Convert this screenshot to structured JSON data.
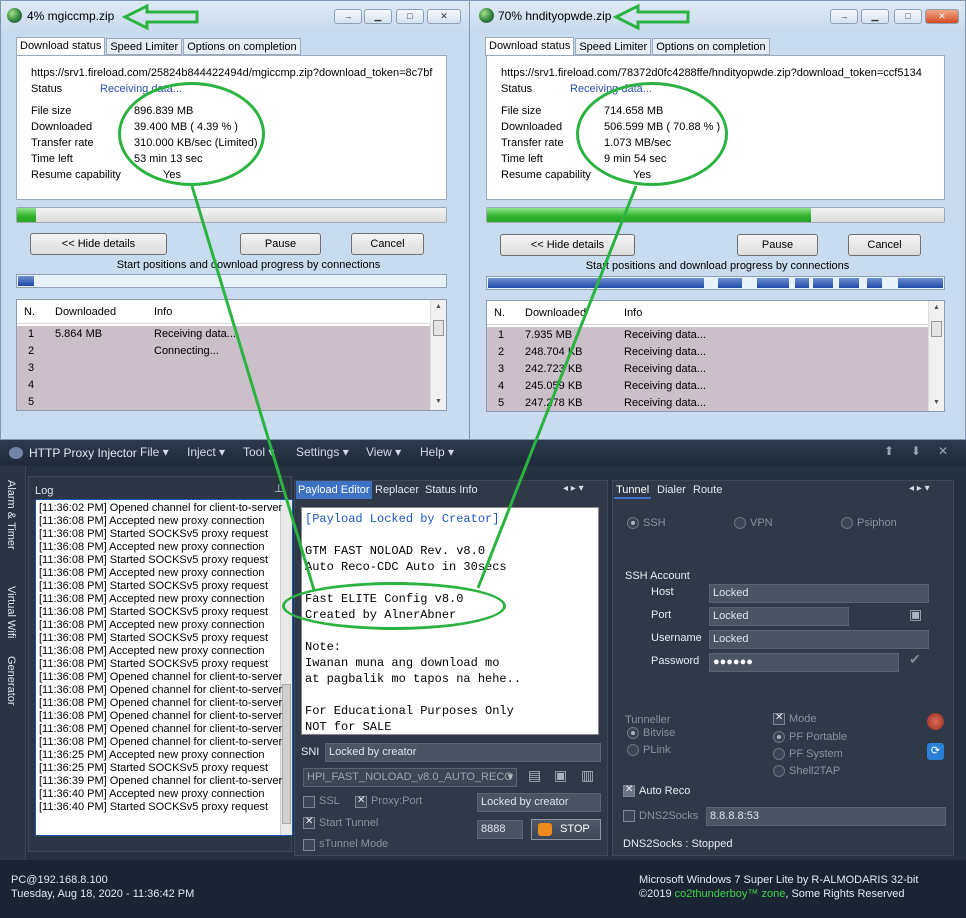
{
  "win1": {
    "title": "4% mgiccmp.zip",
    "tabs": [
      "Download status",
      "Speed Limiter",
      "Options on completion"
    ],
    "url": "https://srv1.fireload.com/25824b844422494d/mgiccmp.zip?download_token=8c7bf",
    "status_label": "Status",
    "status_value": "Receiving data...",
    "rows": [
      {
        "label": "File size",
        "value": "896.839 MB"
      },
      {
        "label": "Downloaded",
        "value": "39.400 MB ( 4.39 % )"
      },
      {
        "label": "Transfer rate",
        "value": "310.000 KB/sec (Limited)"
      },
      {
        "label": "Time left",
        "value": "53 min 13 sec"
      },
      {
        "label": "Resume capability",
        "value": "Yes"
      }
    ],
    "progress_pct": 4.39,
    "buttons": {
      "hide": "<< Hide details",
      "pause": "Pause",
      "cancel": "Cancel"
    },
    "caption": "Start positions and download progress by connections",
    "list_headers": [
      "N.",
      "Downloaded",
      "Info"
    ],
    "list_rows": [
      {
        "n": "1",
        "dl": "5.864  MB",
        "info": "Receiving data..."
      },
      {
        "n": "2",
        "dl": "",
        "info": "Connecting..."
      },
      {
        "n": "3",
        "dl": "",
        "info": ""
      },
      {
        "n": "4",
        "dl": "",
        "info": ""
      },
      {
        "n": "5",
        "dl": "",
        "info": ""
      }
    ]
  },
  "win2": {
    "title": "70% hndityopwde.zip",
    "tabs": [
      "Download status",
      "Speed Limiter",
      "Options on completion"
    ],
    "url": "https://srv1.fireload.com/78372d0fc4288ffe/hndityopwde.zip?download_token=ccf5134",
    "status_label": "Status",
    "status_value": "Receiving data...",
    "rows": [
      {
        "label": "File size",
        "value": "714.658 MB"
      },
      {
        "label": "Downloaded",
        "value": "506.599 MB ( 70.88 % )"
      },
      {
        "label": "Transfer rate",
        "value": "1.073 MB/sec"
      },
      {
        "label": "Time left",
        "value": "9 min 54 sec"
      },
      {
        "label": "Resume capability",
        "value": "Yes"
      }
    ],
    "progress_pct": 70.88,
    "buttons": {
      "hide": "<< Hide details",
      "pause": "Pause",
      "cancel": "Cancel"
    },
    "caption": "Start positions and download progress by connections",
    "list_headers": [
      "N.",
      "Downloaded",
      "Info"
    ],
    "list_rows": [
      {
        "n": "1",
        "dl": "7.935  MB",
        "info": "Receiving data..."
      },
      {
        "n": "2",
        "dl": "248.704  KB",
        "info": "Receiving data..."
      },
      {
        "n": "3",
        "dl": "242.723  KB",
        "info": "Receiving data..."
      },
      {
        "n": "4",
        "dl": "245.059  KB",
        "info": "Receiving data..."
      },
      {
        "n": "5",
        "dl": "247.278  KB",
        "info": "Receiving data..."
      }
    ]
  },
  "injector": {
    "title": "HTTP Proxy Injector",
    "menu": [
      "File ▾",
      "Inject ▾",
      "Tool ▾",
      "Settings ▾",
      "View ▾",
      "Help ▾"
    ],
    "side_tabs": [
      "Alarm & Timer",
      "Virtual Wifi",
      "Generator"
    ],
    "log_title": "Log",
    "log_lines": [
      "[11:36:02 PM] Opened channel for client-to-server",
      "[11:36:08 PM] Accepted new proxy connection",
      "[11:36:08 PM] Started SOCKSv5 proxy request",
      "[11:36:08 PM] Accepted new proxy connection",
      "[11:36:08 PM] Started SOCKSv5 proxy request",
      "[11:36:08 PM] Accepted new proxy connection",
      "[11:36:08 PM] Started SOCKSv5 proxy request",
      "[11:36:08 PM] Accepted new proxy connection",
      "[11:36:08 PM] Started SOCKSv5 proxy request",
      "[11:36:08 PM] Accepted new proxy connection",
      "[11:36:08 PM] Started SOCKSv5 proxy request",
      "[11:36:08 PM] Accepted new proxy connection",
      "[11:36:08 PM] Started SOCKSv5 proxy request",
      "[11:36:08 PM] Opened channel for client-to-server",
      "[11:36:08 PM] Opened channel for client-to-server",
      "[11:36:08 PM] Opened channel for client-to-server",
      "[11:36:08 PM] Opened channel for client-to-server",
      "[11:36:08 PM] Opened channel for client-to-server",
      "[11:36:08 PM] Opened channel for client-to-server",
      "[11:36:25 PM] Accepted new proxy connection",
      "[11:36:25 PM] Started SOCKSv5 proxy request",
      "[11:36:39 PM] Opened channel for client-to-server",
      "[11:36:40 PM] Accepted new proxy connection",
      "[11:36:40 PM] Started SOCKSv5 proxy request"
    ],
    "mid_tabs": [
      "Payload Editor",
      "Replacer",
      "Status Info"
    ],
    "payload": [
      "[Payload Locked by Creator]",
      "",
      "GTM FAST NOLOAD Rev. v8.0",
      "Auto Reco-CDC Auto in 30secs",
      "",
      "Fast ELITE Config v8.0",
      "Created by AlnerAbner",
      "",
      "Note:",
      "Iwanan muna ang download mo",
      "at pagbalik mo tapos na hehe..",
      "",
      "For Educational Purposes Only",
      "NOT for SALE"
    ],
    "sni_label": "SNI",
    "sni_value": "Locked by creator",
    "config_select": "HPI_FAST_NOLOAD_v8.0_AUTO_RECO",
    "ssl_label": "SSL",
    "proxy_port_label": "Proxy:Port",
    "proxy_value": "Locked by creator",
    "start_tunnel_label": "Start Tunnel",
    "port_value": "8888",
    "stop_label": "STOP",
    "stunnel_label": "sTunnel Mode",
    "right_tabs": [
      "Tunnel",
      "Dialer",
      "Route"
    ],
    "modes": [
      "SSH",
      "VPN",
      "Psiphon"
    ],
    "ssh_account": "SSH Account",
    "host_label": "Host",
    "host_value": "Locked",
    "port_label": "Port",
    "port_field": "Locked",
    "user_label": "Username",
    "user_value": "Locked",
    "pass_label": "Password",
    "pass_value": "●●●●●●",
    "tunneler_label": "Tunneller",
    "bitvise": "Bitvise",
    "plink": "PLink",
    "mode_label": "Mode",
    "pf_portable": "PF Portable",
    "pf_system": "PF System",
    "shell2tap": "Shell2TAP",
    "auto_reco": "Auto Reco",
    "dns2socks_label": "DNS2Socks",
    "dns_value": "8.8.8.8:53",
    "dns_status": "DNS2Socks : Stopped"
  },
  "statusbar": {
    "host": "PC@192.168.8.100",
    "datetime": "Tuesday, Aug 18, 2020 - 11:36:42 PM",
    "os": "Microsoft Windows 7 Super Lite by R-ALMODARIS  32-bit",
    "copyright_prefix": "©2019 ",
    "brand": "co2thunderboy™ zone",
    "copyright_suffix": ", Some Rights Reserved"
  },
  "colors": {
    "accent_green": "#2bb341",
    "selected_tab": "#3d73c2",
    "progress_green": "#2fb22c",
    "brand_green": "#3fd14a"
  }
}
